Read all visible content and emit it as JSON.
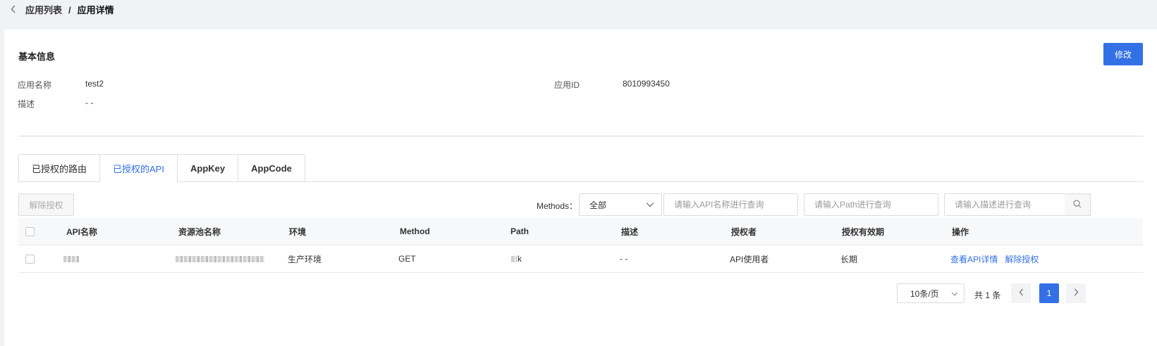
{
  "breadcrumb": {
    "parent": "应用列表",
    "separator": "/",
    "current": "应用详情"
  },
  "basic_info": {
    "title": "基本信息",
    "edit_label": "修改",
    "app_name_label": "应用名称",
    "app_name_value": "test2",
    "app_id_label": "应用ID",
    "app_id_value": "8010993450",
    "desc_label": "描述",
    "desc_value": "- -"
  },
  "tabs": [
    {
      "label": "已授权的路由",
      "active": false
    },
    {
      "label": "已授权的API",
      "active": true
    },
    {
      "label": "AppKey",
      "active": false
    },
    {
      "label": "AppCode",
      "active": false
    }
  ],
  "toolbar": {
    "revoke_label": "解除授权",
    "methods_label": "Methods：",
    "methods_selected": "全部",
    "api_name_placeholder": "请输入API名称进行查询",
    "path_placeholder": "请输入Path进行查询",
    "desc_placeholder": "请输入描述进行查询"
  },
  "table": {
    "columns": [
      "API名称",
      "资源池名称",
      "环境",
      "Method",
      "Path",
      "描述",
      "授权者",
      "授权有效期",
      "操作"
    ],
    "rows": [
      {
        "env": "生产环境",
        "method": "GET",
        "path_suffix": "k",
        "desc": "- -",
        "grantor": "API使用者",
        "validity": "长期",
        "action_view": "查看API详情",
        "action_revoke": "解除授权"
      }
    ]
  },
  "pagination": {
    "page_size": "10条/页",
    "total": "共 1 条",
    "current_page": "1"
  },
  "colors": {
    "primary": "#3370e6"
  }
}
